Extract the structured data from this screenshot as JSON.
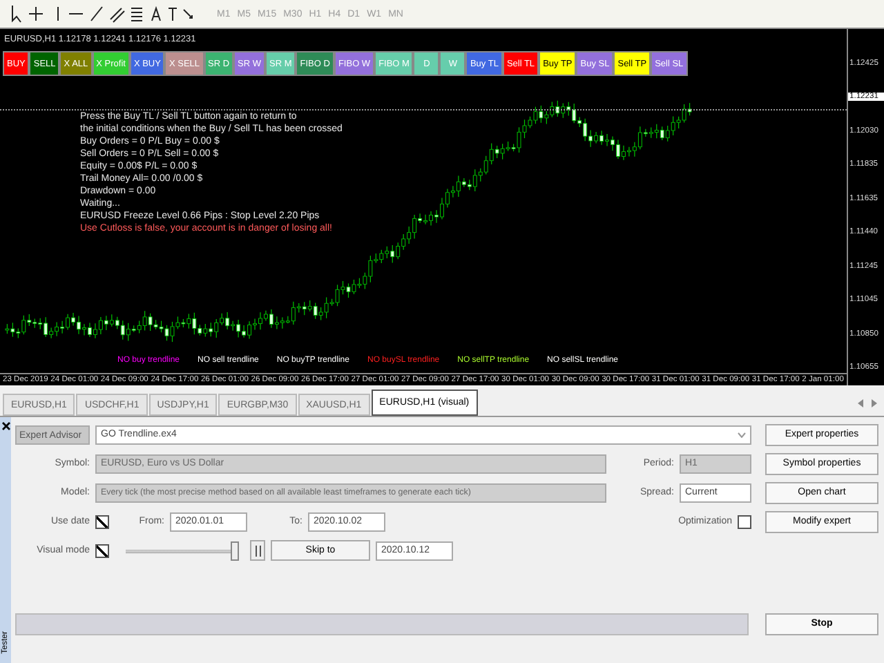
{
  "toolbar": {
    "timeframes": [
      {
        "label": "M1",
        "disabled": true
      },
      {
        "label": "M5",
        "disabled": true
      },
      {
        "label": "M15",
        "disabled": true
      },
      {
        "label": "M30",
        "disabled": true
      },
      {
        "label": "H1",
        "disabled": true
      },
      {
        "label": "H4",
        "disabled": true
      },
      {
        "label": "D1",
        "disabled": true
      },
      {
        "label": "W1",
        "disabled": true
      },
      {
        "label": "MN",
        "disabled": true
      }
    ]
  },
  "chart": {
    "title": "EURUSD,H1  1.12178 1.12241 1.12176 1.12231",
    "buttons": [
      {
        "label": "BUY",
        "color": "#ff0000"
      },
      {
        "label": "SELL",
        "color": "#006400"
      },
      {
        "label": "X ALL",
        "color": "#808000"
      },
      {
        "label": "X Profit",
        "color": "#32cd32"
      },
      {
        "label": "X BUY",
        "color": "#4169e1"
      },
      {
        "label": "X SELL",
        "color": "#bc8f8f"
      },
      {
        "label": "SR D",
        "color": "#3cb371"
      },
      {
        "label": "SR W",
        "color": "#9370db"
      },
      {
        "label": "SR M",
        "color": "#66cdaa"
      },
      {
        "label": "FIBO D",
        "color": "#2e8b57"
      },
      {
        "label": "FIBO W",
        "color": "#9370db"
      },
      {
        "label": "FIBO M",
        "color": "#66cdaa"
      },
      {
        "label": "D",
        "color": "#66cdab"
      },
      {
        "label": "W",
        "color": "#66cdac"
      },
      {
        "label": "Buy TL",
        "color": "#4169e2"
      },
      {
        "label": "Sell TL",
        "color": "#ff0001"
      },
      {
        "label": "Buy TP",
        "color": "#ffff00"
      },
      {
        "label": "Buy SL",
        "color": "#9370dc"
      },
      {
        "label": "Sell TP",
        "color": "#ffff01"
      },
      {
        "label": "Sell SL",
        "color": "#9370dd"
      }
    ],
    "info_lines": [
      {
        "text": "Press the Buy TL / Sell TL button again to return to",
        "kind": "info"
      },
      {
        "text": "the initial conditions when the Buy / Sell TL has been crossed",
        "kind": "info"
      },
      {
        "text": "Buy Orders = 0   P/L Buy = 0.00 $",
        "kind": "info"
      },
      {
        "text": "Sell Orders = 0   P/L Sell = 0.00 $",
        "kind": "info"
      },
      {
        "text": "Equity = 0.00$ P/L = 0.00 $",
        "kind": "info"
      },
      {
        "text": "Trail Money All= 0.00 /0.00 $",
        "kind": "info"
      },
      {
        "text": "Drawdown = 0.00",
        "kind": "info"
      },
      {
        "text": "Waiting...",
        "kind": "info"
      },
      {
        "text": "EURUSD Freeze Level  0.66 Pips : Stop Level 2.20 Pips",
        "kind": "info"
      },
      {
        "text": "Use Cutloss is false, your account is in danger of losing all!",
        "kind": "warning"
      }
    ],
    "trendline_labels": [
      {
        "text": "NO buy trendline",
        "color": "#ff00ff"
      },
      {
        "text": "NO sell trendline",
        "color": "#ffffff"
      },
      {
        "text": "NO buyTP trendline",
        "color": "#fffffe"
      },
      {
        "text": "NO buySL trendline",
        "color": "#ff2020"
      },
      {
        "text": "NO sellTP trendline",
        "color": "#adff2f"
      },
      {
        "text": "NO sellSL trendline",
        "color": "#fffffd"
      }
    ],
    "price_labels": [
      {
        "text": "1.12425",
        "current": false
      },
      {
        "text": "1.12231",
        "current": true
      },
      {
        "text": "1.12030",
        "current": false
      },
      {
        "text": "1.11835",
        "current": false
      },
      {
        "text": "1.11635",
        "current": false
      },
      {
        "text": "1.11440",
        "current": false
      },
      {
        "text": "1.11245",
        "current": false
      },
      {
        "text": "1.11045",
        "current": false
      },
      {
        "text": "1.10850",
        "current": false
      },
      {
        "text": "1.10655",
        "current": false
      }
    ],
    "time_labels": [
      "23 Dec 2019",
      "24 Dec 01:00",
      "24 Dec 09:00",
      "24 Dec 17:00",
      "26 Dec 01:00",
      "26 Dec 09:00",
      "26 Dec 17:00",
      "27 Dec 01:00",
      "27 Dec 09:00",
      "27 Dec 17:00",
      "30 Dec 01:00",
      "30 Dec 09:00",
      "30 Dec 17:00",
      "31 Dec 01:00",
      "31 Dec 09:00",
      "31 Dec 17:00",
      "2 Jan 01:00"
    ]
  },
  "tabs": [
    {
      "label": "EURUSD,H1",
      "selected": false
    },
    {
      "label": "USDCHF,H1",
      "selected": false
    },
    {
      "label": "USDJPY,H1",
      "selected": false
    },
    {
      "label": "EURGBP,M30",
      "selected": false
    },
    {
      "label": "XAUUSD,H1",
      "selected": false
    },
    {
      "label": "EURUSD,H1 (visual)",
      "selected": true
    }
  ],
  "tester": {
    "side_title": "Tester",
    "expert_label": "Expert Advisor",
    "expert": "GO Trendline.ex4",
    "symbol_label": "Symbol:",
    "symbol": "EURUSD, Euro vs US Dollar",
    "period_label": "Period:",
    "period": "H1",
    "model_label": "Model:",
    "model": "Every tick (the most precise method based on all available least timeframes to generate each tick)",
    "spread_label": "Spread:",
    "spread": "Current",
    "use_date_label": "Use date",
    "use_date_checked": true,
    "from_label": "From:",
    "from": "2020.01.01",
    "to_label": "To:",
    "to": "2020.10.02",
    "optimization_label": "Optimization",
    "optimization_checked": false,
    "visual_mode_label": "Visual mode",
    "visual_mode_checked": true,
    "speed": {
      "level": 0.97
    },
    "skip_to_button": "Skip to",
    "skip_to": "2020.10.12",
    "progress": {
      "level": 0
    },
    "buttons": {
      "expert_properties": "Expert properties",
      "symbol_properties": "Symbol properties",
      "open_chart": "Open chart",
      "modify_expert": "Modify expert",
      "stop": "Stop"
    }
  }
}
